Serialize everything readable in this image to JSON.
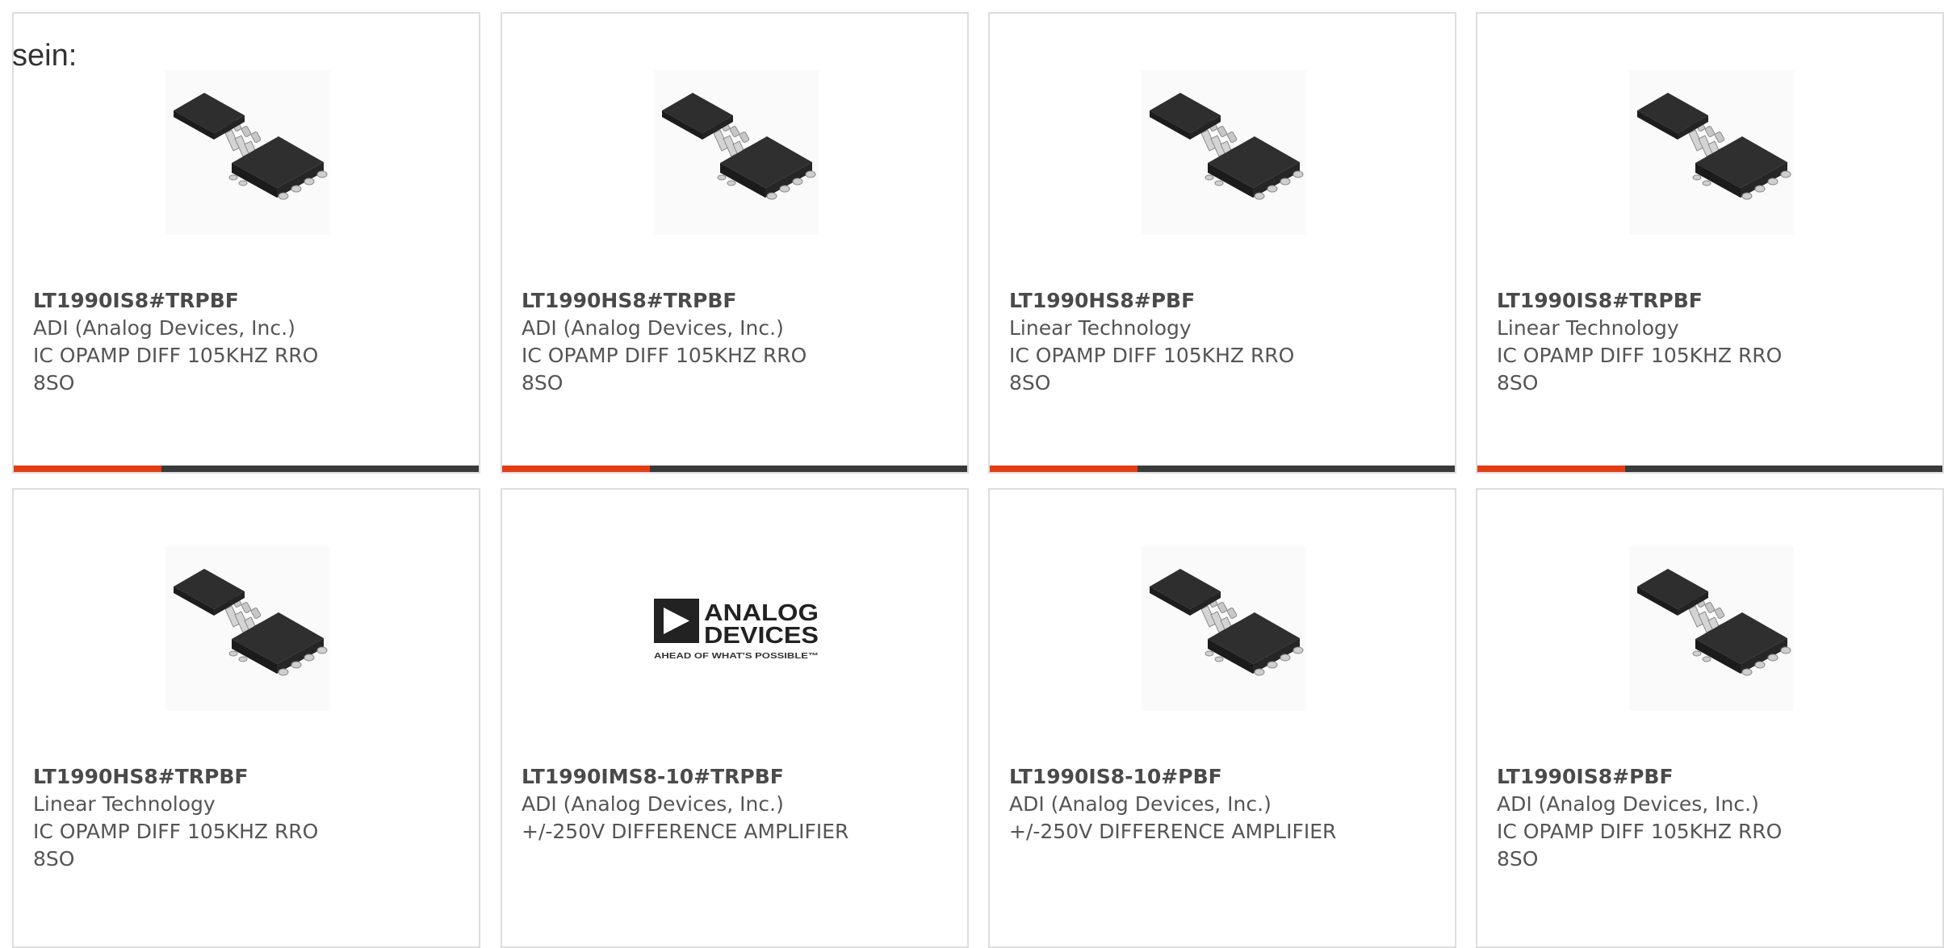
{
  "page": {
    "intro_text": "sein:"
  },
  "colors": {
    "accent": "#e43d13",
    "bar": "#3a3a3a",
    "text": "#555555",
    "border": "#dddddd"
  },
  "products": [
    {
      "part_number": "LT1990IS8#TRPBF",
      "manufacturer": "ADI (Analog Devices, Inc.)",
      "desc_line1": "IC OPAMP DIFF 105KHZ RRO",
      "desc_line2": "8SO",
      "image": "so8-chip-icon"
    },
    {
      "part_number": "LT1990HS8#TRPBF",
      "manufacturer": "ADI (Analog Devices, Inc.)",
      "desc_line1": "IC OPAMP DIFF 105KHZ RRO",
      "desc_line2": "8SO",
      "image": "so8-chip-icon"
    },
    {
      "part_number": "LT1990HS8#PBF",
      "manufacturer": "Linear Technology",
      "desc_line1": "IC OPAMP DIFF 105KHZ RRO",
      "desc_line2": "8SO",
      "image": "so8-chip-icon"
    },
    {
      "part_number": "LT1990IS8#TRPBF",
      "manufacturer": "Linear Technology",
      "desc_line1": "IC OPAMP DIFF 105KHZ RRO",
      "desc_line2": "8SO",
      "image": "so8-chip-icon"
    },
    {
      "part_number": "LT1990HS8#TRPBF",
      "manufacturer": "Linear Technology",
      "desc_line1": "IC OPAMP DIFF 105KHZ RRO",
      "desc_line2": "8SO",
      "image": "so8-chip-icon"
    },
    {
      "part_number": "LT1990IMS8-10#TRPBF",
      "manufacturer": "ADI (Analog Devices, Inc.)",
      "desc_line1": "+/-250V DIFFERENCE AMPLIFIER",
      "desc_line2": "",
      "image": "analog-devices-logo",
      "logo": {
        "line1": "ANALOG",
        "line2": "DEVICES",
        "tagline": "AHEAD OF WHAT'S POSSIBLE™"
      }
    },
    {
      "part_number": "LT1990IS8-10#PBF",
      "manufacturer": "ADI (Analog Devices, Inc.)",
      "desc_line1": "+/-250V DIFFERENCE AMPLIFIER",
      "desc_line2": "",
      "image": "so8-chip-icon"
    },
    {
      "part_number": "LT1990IS8#PBF",
      "manufacturer": "ADI (Analog Devices, Inc.)",
      "desc_line1": "IC OPAMP DIFF 105KHZ RRO",
      "desc_line2": "8SO",
      "image": "so8-chip-icon"
    }
  ]
}
